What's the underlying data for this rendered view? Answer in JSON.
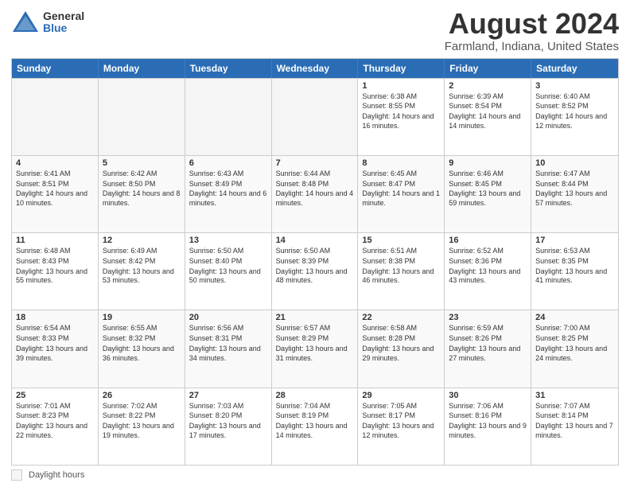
{
  "logo": {
    "general": "General",
    "blue": "Blue"
  },
  "title": "August 2024",
  "subtitle": "Farmland, Indiana, United States",
  "days": [
    "Sunday",
    "Monday",
    "Tuesday",
    "Wednesday",
    "Thursday",
    "Friday",
    "Saturday"
  ],
  "weeks": [
    [
      {
        "day": "",
        "empty": true
      },
      {
        "day": "",
        "empty": true
      },
      {
        "day": "",
        "empty": true
      },
      {
        "day": "",
        "empty": true
      },
      {
        "day": "1",
        "sunrise": "6:38 AM",
        "sunset": "8:55 PM",
        "daylight": "14 hours and 16 minutes."
      },
      {
        "day": "2",
        "sunrise": "6:39 AM",
        "sunset": "8:54 PM",
        "daylight": "14 hours and 14 minutes."
      },
      {
        "day": "3",
        "sunrise": "6:40 AM",
        "sunset": "8:52 PM",
        "daylight": "14 hours and 12 minutes."
      }
    ],
    [
      {
        "day": "4",
        "sunrise": "6:41 AM",
        "sunset": "8:51 PM",
        "daylight": "14 hours and 10 minutes."
      },
      {
        "day": "5",
        "sunrise": "6:42 AM",
        "sunset": "8:50 PM",
        "daylight": "14 hours and 8 minutes."
      },
      {
        "day": "6",
        "sunrise": "6:43 AM",
        "sunset": "8:49 PM",
        "daylight": "14 hours and 6 minutes."
      },
      {
        "day": "7",
        "sunrise": "6:44 AM",
        "sunset": "8:48 PM",
        "daylight": "14 hours and 4 minutes."
      },
      {
        "day": "8",
        "sunrise": "6:45 AM",
        "sunset": "8:47 PM",
        "daylight": "14 hours and 1 minute."
      },
      {
        "day": "9",
        "sunrise": "6:46 AM",
        "sunset": "8:45 PM",
        "daylight": "13 hours and 59 minutes."
      },
      {
        "day": "10",
        "sunrise": "6:47 AM",
        "sunset": "8:44 PM",
        "daylight": "13 hours and 57 minutes."
      }
    ],
    [
      {
        "day": "11",
        "sunrise": "6:48 AM",
        "sunset": "8:43 PM",
        "daylight": "13 hours and 55 minutes."
      },
      {
        "day": "12",
        "sunrise": "6:49 AM",
        "sunset": "8:42 PM",
        "daylight": "13 hours and 53 minutes."
      },
      {
        "day": "13",
        "sunrise": "6:50 AM",
        "sunset": "8:40 PM",
        "daylight": "13 hours and 50 minutes."
      },
      {
        "day": "14",
        "sunrise": "6:50 AM",
        "sunset": "8:39 PM",
        "daylight": "13 hours and 48 minutes."
      },
      {
        "day": "15",
        "sunrise": "6:51 AM",
        "sunset": "8:38 PM",
        "daylight": "13 hours and 46 minutes."
      },
      {
        "day": "16",
        "sunrise": "6:52 AM",
        "sunset": "8:36 PM",
        "daylight": "13 hours and 43 minutes."
      },
      {
        "day": "17",
        "sunrise": "6:53 AM",
        "sunset": "8:35 PM",
        "daylight": "13 hours and 41 minutes."
      }
    ],
    [
      {
        "day": "18",
        "sunrise": "6:54 AM",
        "sunset": "8:33 PM",
        "daylight": "13 hours and 39 minutes."
      },
      {
        "day": "19",
        "sunrise": "6:55 AM",
        "sunset": "8:32 PM",
        "daylight": "13 hours and 36 minutes."
      },
      {
        "day": "20",
        "sunrise": "6:56 AM",
        "sunset": "8:31 PM",
        "daylight": "13 hours and 34 minutes."
      },
      {
        "day": "21",
        "sunrise": "6:57 AM",
        "sunset": "8:29 PM",
        "daylight": "13 hours and 31 minutes."
      },
      {
        "day": "22",
        "sunrise": "6:58 AM",
        "sunset": "8:28 PM",
        "daylight": "13 hours and 29 minutes."
      },
      {
        "day": "23",
        "sunrise": "6:59 AM",
        "sunset": "8:26 PM",
        "daylight": "13 hours and 27 minutes."
      },
      {
        "day": "24",
        "sunrise": "7:00 AM",
        "sunset": "8:25 PM",
        "daylight": "13 hours and 24 minutes."
      }
    ],
    [
      {
        "day": "25",
        "sunrise": "7:01 AM",
        "sunset": "8:23 PM",
        "daylight": "13 hours and 22 minutes."
      },
      {
        "day": "26",
        "sunrise": "7:02 AM",
        "sunset": "8:22 PM",
        "daylight": "13 hours and 19 minutes."
      },
      {
        "day": "27",
        "sunrise": "7:03 AM",
        "sunset": "8:20 PM",
        "daylight": "13 hours and 17 minutes."
      },
      {
        "day": "28",
        "sunrise": "7:04 AM",
        "sunset": "8:19 PM",
        "daylight": "13 hours and 14 minutes."
      },
      {
        "day": "29",
        "sunrise": "7:05 AM",
        "sunset": "8:17 PM",
        "daylight": "13 hours and 12 minutes."
      },
      {
        "day": "30",
        "sunrise": "7:06 AM",
        "sunset": "8:16 PM",
        "daylight": "13 hours and 9 minutes."
      },
      {
        "day": "31",
        "sunrise": "7:07 AM",
        "sunset": "8:14 PM",
        "daylight": "13 hours and 7 minutes."
      }
    ]
  ],
  "legend": {
    "label": "Daylight hours"
  },
  "labels": {
    "sunrise": "Sunrise:",
    "sunset": "Sunset:",
    "daylight": "Daylight:"
  }
}
